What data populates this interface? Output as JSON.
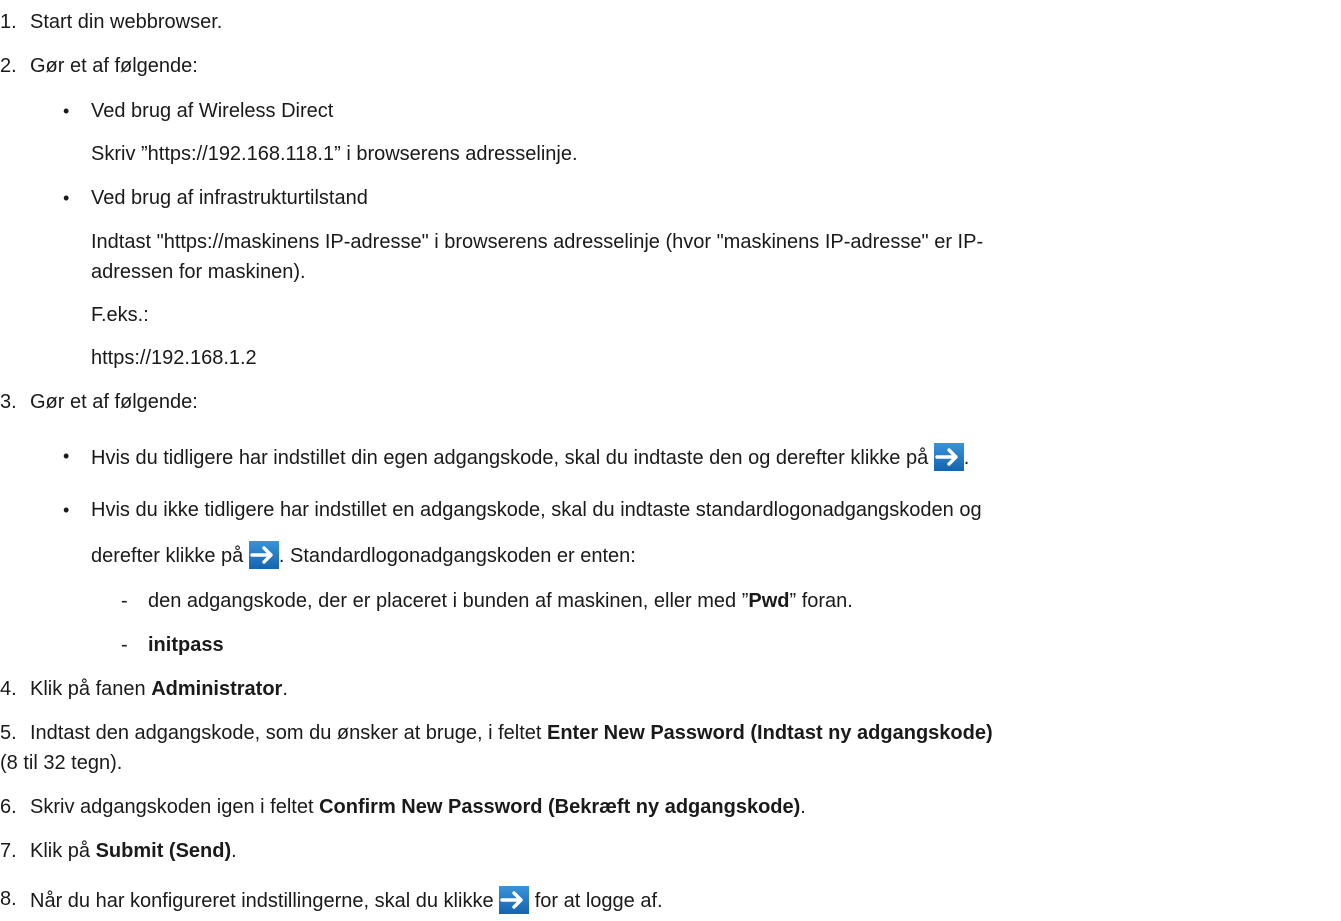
{
  "steps": {
    "s1": {
      "num": "1.",
      "text": "Start din webbrowser."
    },
    "s2": {
      "num": "2.",
      "text": "Gør et af følgende:",
      "b1": {
        "title": "Ved brug af Wireless Direct",
        "text": "Skriv ”https://192.168.118.1” i browserens adresselinje."
      },
      "b2": {
        "title": "Ved brug af infrastrukturtilstand",
        "line1": "Indtast \"https://maskinens IP-adresse\" i browserens adresselinje (hvor \"maskinens IP-adresse\" er IP-",
        "line2": "adressen for maskinen).",
        "ex_label": "F.eks.:",
        "ex_value": "https://192.168.1.2"
      }
    },
    "s3": {
      "num": "3.",
      "text": "Gør et af følgende:",
      "b1": {
        "text": "Hvis du tidligere har indstillet din egen adgangskode, skal du indtaste den og derefter klikke på",
        "after": "."
      },
      "b2": {
        "line1": "Hvis du ikke tidligere har indstillet en adgangskode, skal du indtaste standardlogonadgangskoden og",
        "line2_pre": "derefter klikke på",
        "line2_post": ". Standardlogonadgangskoden er enten:",
        "d1_pre": "den adgangskode, der er placeret i bunden af maskinen, eller med ”",
        "d1_bold": "Pwd",
        "d1_post": "” foran.",
        "d2_bold": "initpass"
      }
    },
    "s4": {
      "num": "4.",
      "pre": "Klik på fanen ",
      "bold": "Administrator",
      "post": "."
    },
    "s5": {
      "num": "5.",
      "pre": "Indtast den adgangskode, som du ønsker at bruge, i feltet ",
      "bold": "Enter New Password (Indtast ny adgangskode)",
      "line2": "(8 til 32 tegn)."
    },
    "s6": {
      "num": "6.",
      "pre": "Skriv adgangskoden igen i feltet ",
      "bold": "Confirm New Password (Bekræft ny adgangskode)",
      "post": "."
    },
    "s7": {
      "num": "7.",
      "pre": "Klik på ",
      "bold": "Submit (Send)",
      "post": "."
    },
    "s8": {
      "num": "8.",
      "pre": "Når du har konfigureret indstillingerne, skal du klikke",
      "post": " for at logge af."
    }
  },
  "icons": {
    "arrow": "right-arrow-icon",
    "arrow_color": "#1b6fbf"
  }
}
